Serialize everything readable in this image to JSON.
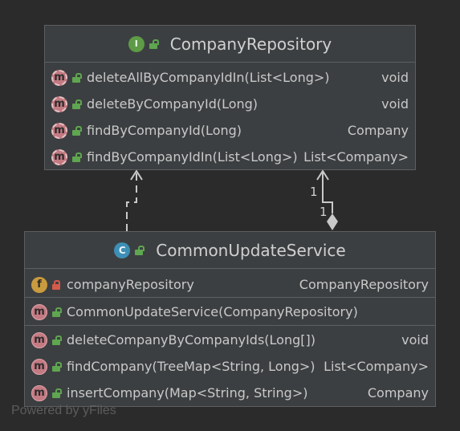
{
  "repository": {
    "kind_icon": "interface-icon",
    "kind_letter": "I",
    "name": "CompanyRepository",
    "methods": [
      {
        "icon": "abstract-method-icon",
        "letter": "m",
        "name": "deleteAllByCompanyIdIn(List<Long>)",
        "type": "void"
      },
      {
        "icon": "abstract-method-icon",
        "letter": "m",
        "name": "deleteByCompanyId(Long)",
        "type": "void"
      },
      {
        "icon": "abstract-method-icon",
        "letter": "m",
        "name": "findByCompanyId(Long)",
        "type": "Company"
      },
      {
        "icon": "abstract-method-icon",
        "letter": "m",
        "name": "findByCompanyIdIn(List<Long>)",
        "type": "List<Company>"
      }
    ]
  },
  "service": {
    "kind_icon": "class-icon",
    "kind_letter": "C",
    "name": "CommonUpdateService",
    "field": {
      "icon": "field-icon",
      "letter": "f",
      "name": "companyRepository",
      "type": "CompanyRepository"
    },
    "constructor": {
      "icon": "method-icon",
      "letter": "m",
      "name": "CommonUpdateService(CompanyRepository)"
    },
    "methods": [
      {
        "icon": "method-icon",
        "letter": "m",
        "name": "deleteCompanyByCompanyIds(Long[])",
        "type": "void"
      },
      {
        "icon": "method-icon",
        "letter": "m",
        "name": "findCompany(TreeMap<String, Long>)",
        "type": "List<Company>"
      },
      {
        "icon": "method-icon",
        "letter": "m",
        "name": "insertCompany(Map<String, String>)",
        "type": "Company"
      }
    ]
  },
  "association": {
    "source_multiplicity": "1",
    "target_multiplicity": "1"
  },
  "watermark": "Powered by yFiles",
  "colors": {
    "background": "#2b2b2b",
    "node_fill": "#3c3f41",
    "node_border": "#5d5f61",
    "edge": "#c9c9c9",
    "public_lock": "#5fa650",
    "private_lock": "#d45a4a"
  }
}
